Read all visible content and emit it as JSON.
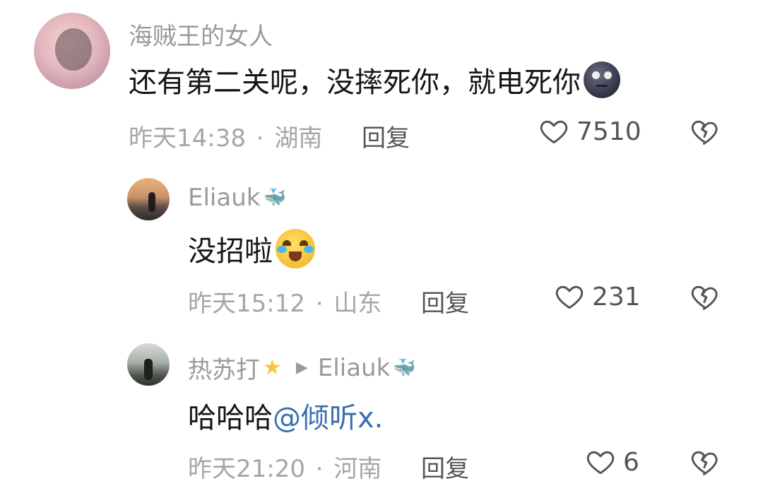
{
  "comments": [
    {
      "username": "海贼王的女人",
      "text": "还有第二关呢，没摔死你，就电死你",
      "emoji": "new-moon-face",
      "time": "昨天14:38",
      "separator": "·",
      "location": "湖南",
      "reply_label": "回复",
      "likes": "7510"
    },
    {
      "username": "Eliauk",
      "badge": "whale",
      "text": "没招啦",
      "emoji": "crying-laughing-face",
      "time": "昨天15:12",
      "separator": "·",
      "location": "山东",
      "reply_label": "回复",
      "likes": "231"
    },
    {
      "username": "热苏打",
      "badge": "star",
      "reply_to": "Eliauk",
      "reply_to_badge": "whale",
      "text": "哈哈哈",
      "mention": "@倾听x.",
      "time": "昨天21:20",
      "separator": "·",
      "location": "河南",
      "reply_label": "回复",
      "likes": "6"
    }
  ],
  "colors": {
    "mention": "#3b6fb0",
    "meta": "#a6a6a6",
    "username": "#9a9a9a"
  }
}
